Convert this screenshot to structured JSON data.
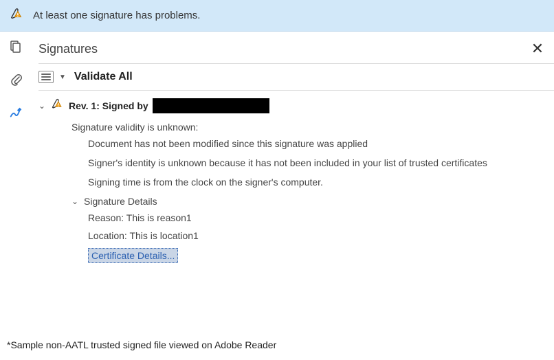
{
  "banner": {
    "text": "At least one signature has problems."
  },
  "panel": {
    "title": "Signatures",
    "validate_label": "Validate All"
  },
  "signature": {
    "rev_label": "Rev. 1: Signed by",
    "validity_heading": "Signature validity is unknown:",
    "status_lines": [
      "Document has not been modified since this signature was applied",
      "Signer's identity is unknown because it has not been included in your list of trusted certificates",
      "Signing time is from the clock on the signer's computer."
    ],
    "details": {
      "heading": "Signature Details",
      "reason": "Reason: This is reason1",
      "location": "Location: This is location1",
      "cert_link": "Certificate Details..."
    }
  },
  "caption": "*Sample non-AATL trusted signed file viewed on Adobe Reader"
}
